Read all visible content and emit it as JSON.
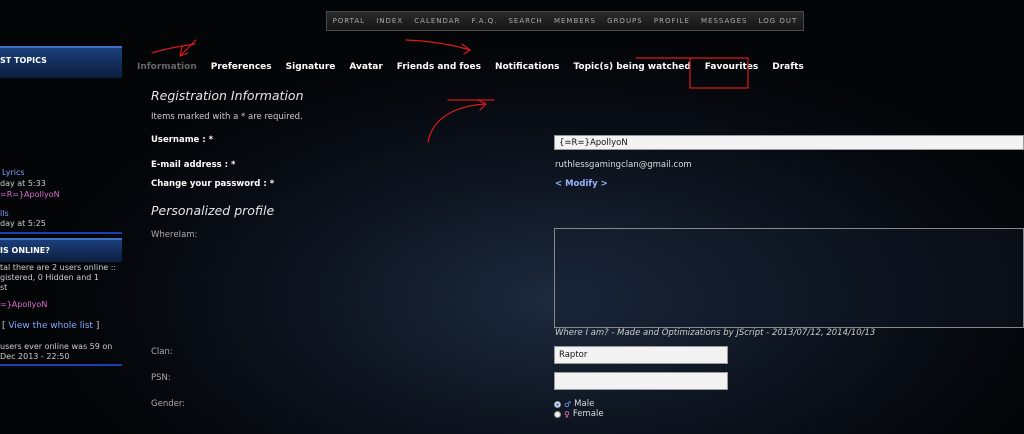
{
  "topnav": {
    "items": [
      "Portal",
      "Index",
      "Calendar",
      "F.A.Q.",
      "Search",
      "Members",
      "Groups",
      "Profile",
      "Messages",
      "Log Out"
    ]
  },
  "sidebar": {
    "latest_header": "ST TOPICS",
    "topics": [
      {
        "title": "Lyrics",
        "time": "day at 5:33",
        "user": "=R=}ApollyoN"
      },
      {
        "title": "lls",
        "time": "day at 5:25"
      }
    ],
    "online_header": "IS ONLINE?",
    "online_text": [
      "tal there are 2 users online ::",
      "gistered, 0 Hidden and 1",
      "st"
    ],
    "online_user": "=}ApollyoN",
    "view_list_prefix": "[",
    "view_list": "View the whole list",
    "view_list_suffix": "]",
    "record_text": [
      "users ever online was 59 on",
      "Dec 2013 - 22:50"
    ]
  },
  "tabs": [
    "Information",
    "Preferences",
    "Signature",
    "Avatar",
    "Friends and foes",
    "Notifications",
    "Topic(s) being watched",
    "Favourites",
    "Drafts"
  ],
  "active_tab": "Information",
  "registration": {
    "heading": "Registration Information",
    "required_note": "Items marked with a * are required.",
    "username_label": "Username : *",
    "username_value": "{=R=}ApollyoN",
    "email_label": "E-mail address : *",
    "email_value": "ruthlessgamingclan@gmail.com",
    "password_label": "Change your password : *",
    "modify_label": "< Modify >"
  },
  "profile": {
    "heading": "Personalized profile",
    "whereiam_label": "WhereIam:",
    "credit": "Where I am? - Made and Optimizations by JScript - 2013/07/12, 2014/10/13",
    "clan_label": "Clan:",
    "clan_value": "Raptor",
    "psn_label": "PSN:",
    "psn_value": "",
    "gender_label": "Gender:",
    "gender_options": [
      "Male",
      "Female"
    ],
    "gender_selected": "Male"
  },
  "colors": {
    "annotation_red": "#d81b1b",
    "sidebar_blue": "#1c3fb0",
    "user_pink": "#e06ad0"
  }
}
